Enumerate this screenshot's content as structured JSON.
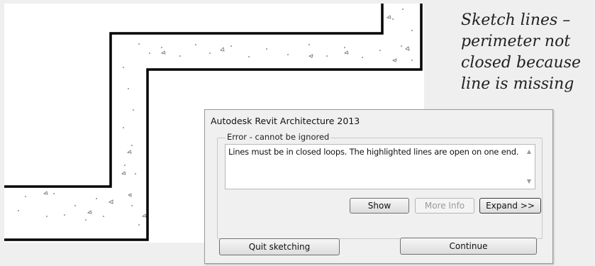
{
  "caption": {
    "text": "Sketch lines – perimeter not closed because line is missing"
  },
  "dialog": {
    "title": "Autodesk Revit Architecture 2013",
    "group_label": "Error - cannot be ignored",
    "message": "Lines must be in closed loops. The highlighted lines are open on one end.",
    "buttons": {
      "show": "Show",
      "more_info": "More Info",
      "expand": "Expand >>",
      "quit": "Quit sketching",
      "continue": "Continue"
    }
  },
  "colors": {
    "sketch_line": "#000000",
    "canvas_bg": "#ffffff",
    "dialog_bg": "#f0f0f0"
  }
}
